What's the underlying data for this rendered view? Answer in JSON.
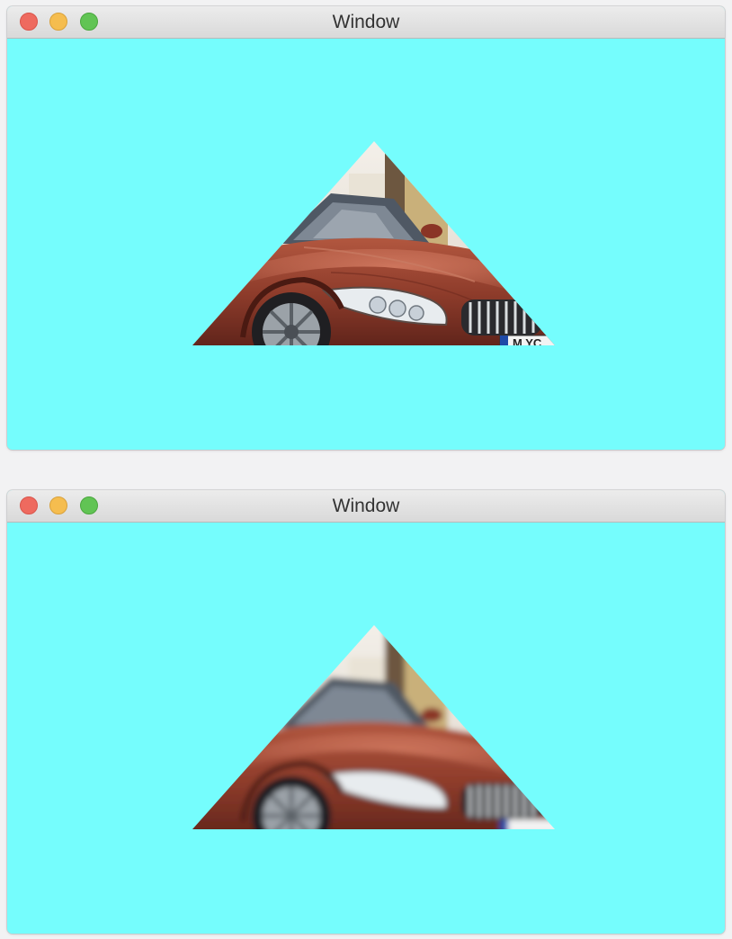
{
  "windows": [
    {
      "title": "Window",
      "controls": [
        "close",
        "minimize",
        "zoom"
      ],
      "background_color": "#75fdfd",
      "image": {
        "kind": "car photo clipped to triangle",
        "rendering": "sharp",
        "license_plate_text": "M  YC"
      }
    },
    {
      "title": "Window",
      "controls": [
        "close",
        "minimize",
        "zoom"
      ],
      "background_color": "#75fdfd",
      "image": {
        "kind": "car photo clipped to triangle",
        "rendering": "blurred"
      }
    }
  ]
}
